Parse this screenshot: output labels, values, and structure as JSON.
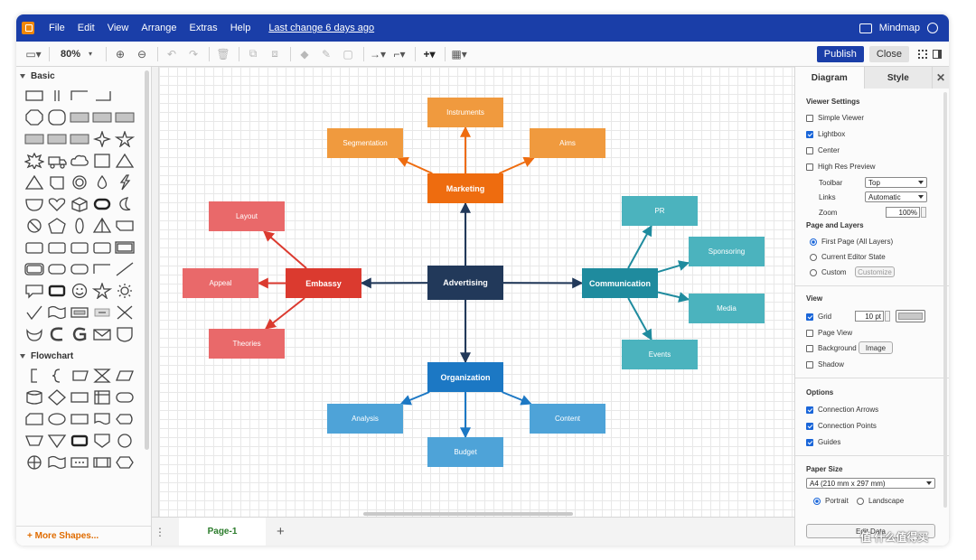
{
  "menubar": {
    "items": [
      "File",
      "Edit",
      "View",
      "Arrange",
      "Extras",
      "Help"
    ],
    "last_change": "Last change 6 days ago",
    "mode_label": "Mindmap"
  },
  "toolbar": {
    "zoom": "80%",
    "publish_label": "Publish",
    "close_label": "Close"
  },
  "sidebar": {
    "sections": [
      "Basic",
      "Flowchart"
    ],
    "more_shapes": "+ More Shapes..."
  },
  "diagram": {
    "center": "Advertising",
    "branches": {
      "marketing": {
        "label": "Marketing",
        "color": "#ee6c0f",
        "children": [
          "Instruments",
          "Segmentation",
          "Aims"
        ],
        "child_color": "#f09a3e"
      },
      "embassy": {
        "label": "Embassy",
        "color": "#db3a2f",
        "children": [
          "Layout",
          "Appeal",
          "Theories"
        ],
        "child_color": "#e9696a"
      },
      "communication": {
        "label": "Communication",
        "color": "#1f8b9e",
        "children": [
          "PR",
          "Sponsoring",
          "Media",
          "Events"
        ],
        "child_color": "#4bb3be"
      },
      "organization": {
        "label": "Organization",
        "color": "#1c78c4",
        "children": [
          "Analysis",
          "Budget",
          "Content"
        ],
        "child_color": "#4ea3d8"
      }
    },
    "center_color": "#22395a"
  },
  "pages": {
    "current": "Page-1"
  },
  "format_panel": {
    "tabs": [
      "Diagram",
      "Style"
    ],
    "viewer_settings": {
      "title": "Viewer Settings",
      "simple_viewer": "Simple Viewer",
      "lightbox": "Lightbox",
      "center": "Center",
      "high_res_preview": "High Res Preview",
      "toolbar_label": "Toolbar",
      "toolbar_value": "Top",
      "links_label": "Links",
      "links_value": "Automatic",
      "zoom_label": "Zoom",
      "zoom_value": "100%"
    },
    "page_layers": {
      "title": "Page and Layers",
      "first_page": "First Page (All Layers)",
      "current_editor": "Current Editor State",
      "custom": "Custom",
      "customize": "Customize"
    },
    "view": {
      "title": "View",
      "grid": "Grid",
      "grid_size": "10 pt",
      "page_view": "Page View",
      "background": "Background",
      "image_btn": "Image",
      "shadow": "Shadow"
    },
    "options": {
      "title": "Options",
      "connection_arrows": "Connection Arrows",
      "connection_points": "Connection Points",
      "guides": "Guides"
    },
    "paper": {
      "title": "Paper Size",
      "size": "A4 (210 mm x 297 mm)",
      "portrait": "Portrait",
      "landscape": "Landscape"
    },
    "edit_data_btn": "Edit Data"
  },
  "watermark": "值 什么值得买"
}
